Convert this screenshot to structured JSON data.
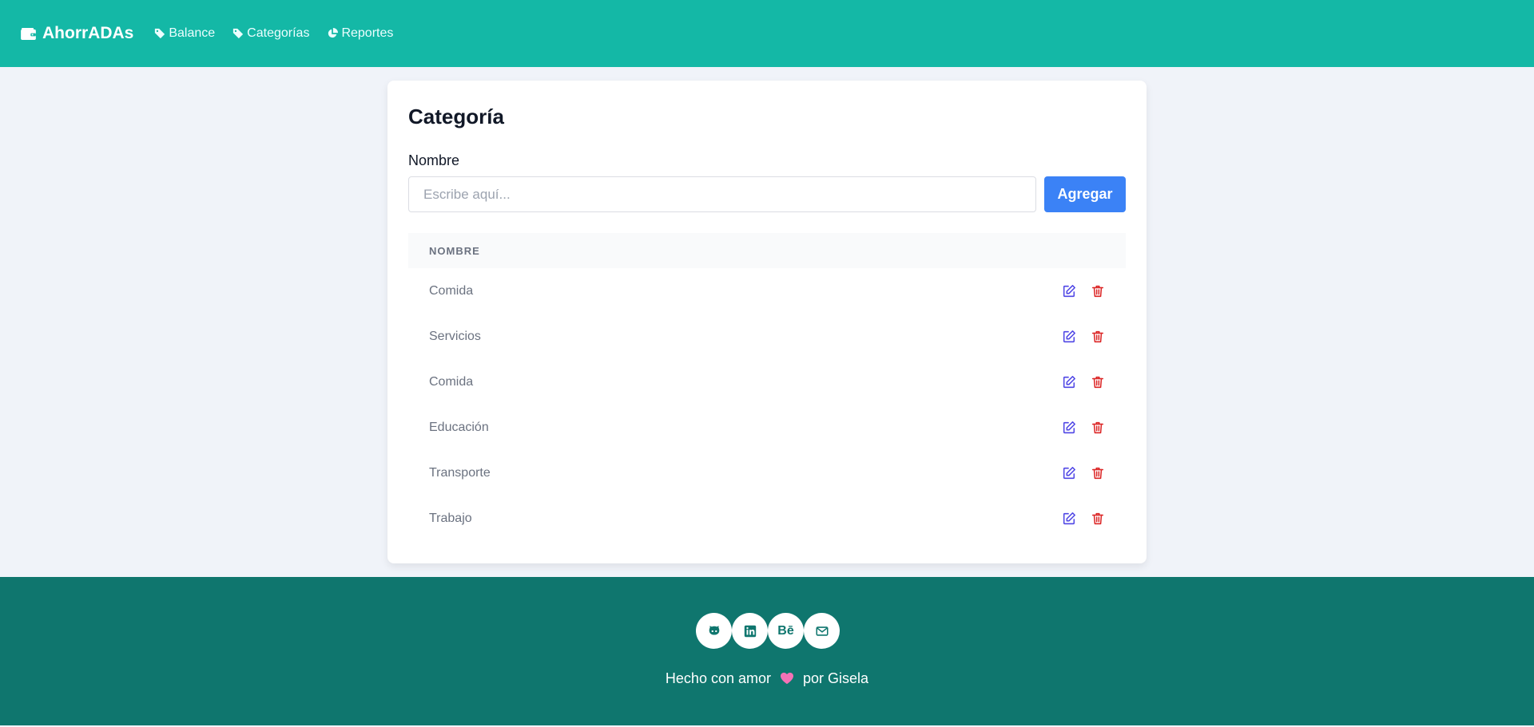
{
  "nav": {
    "brand": "AhorrADAs",
    "links": [
      {
        "label": "Balance",
        "icon": "tag-icon"
      },
      {
        "label": "Categorías",
        "icon": "tag-icon"
      },
      {
        "label": "Reportes",
        "icon": "pie-chart-icon"
      }
    ]
  },
  "card": {
    "title": "Categoría",
    "field_label": "Nombre",
    "input_placeholder": "Escribe aquí...",
    "input_value": "",
    "add_label": "Agregar",
    "table_header": "NOMBRE",
    "rows": [
      {
        "name": "Comida"
      },
      {
        "name": "Servicios"
      },
      {
        "name": "Comida"
      },
      {
        "name": "Educación"
      },
      {
        "name": "Transporte"
      },
      {
        "name": "Trabajo"
      }
    ]
  },
  "footer": {
    "socials": [
      "github-icon",
      "linkedin-icon",
      "behance-icon",
      "mail-icon"
    ],
    "behance_text": "Bē",
    "credit_before": "Hecho con amor",
    "credit_after": "por Gisela"
  },
  "colors": {
    "navbar": "#14b8a6",
    "footer": "#0f766e",
    "primary_button": "#3b82f6",
    "edit_icon": "#4f46e5",
    "delete_icon": "#dc2626",
    "heart": "#f472b6"
  }
}
